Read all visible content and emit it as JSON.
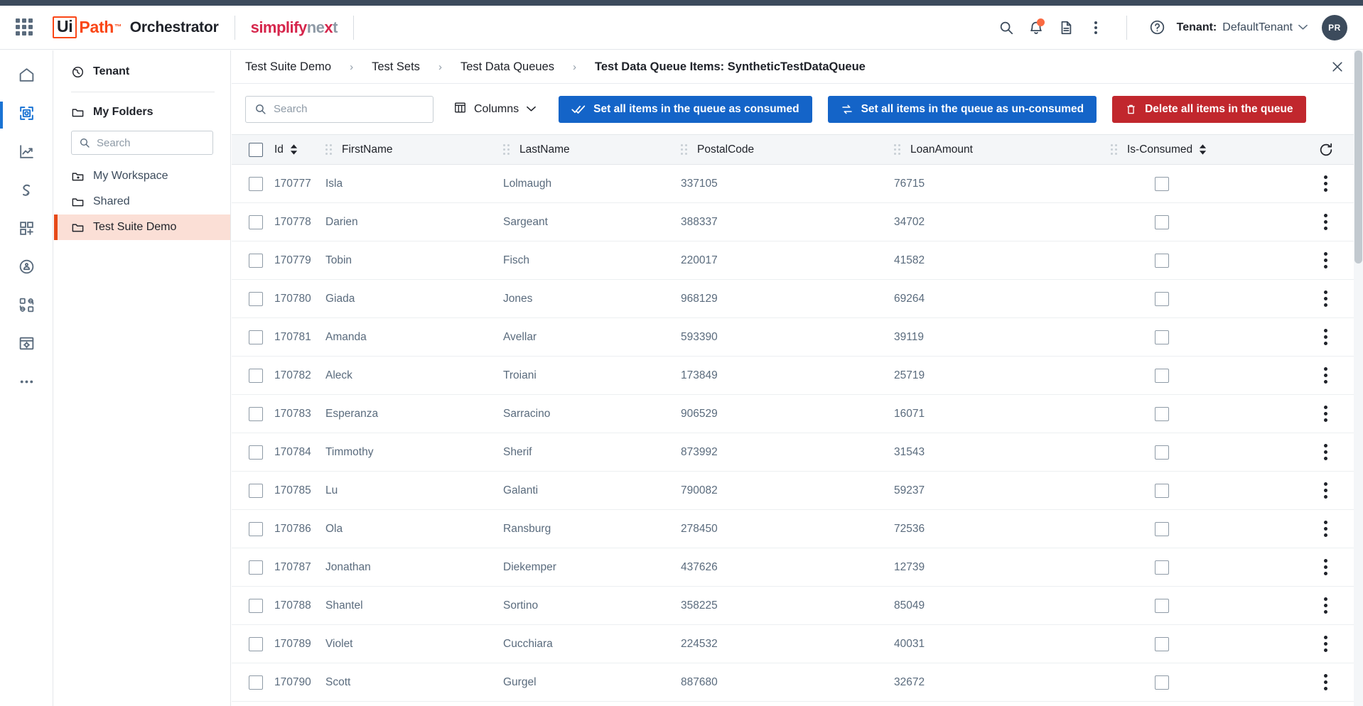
{
  "header": {
    "apps_icon": "waffle-grid-icon",
    "logo": {
      "ui": "Ui",
      "path": "Path",
      "tm": "™"
    },
    "product": "Orchestrator",
    "partner": {
      "part1": "simplify",
      "part2": "ne",
      "part3": "x",
      "part4": "t"
    },
    "icons": [
      "search-icon",
      "notifications-bell-icon",
      "documentation-page-icon",
      "more-vertical-icon",
      "help-circle-icon"
    ],
    "tenant_label": "Tenant:",
    "tenant_value": "DefaultTenant",
    "avatar_initials": "PR",
    "accent_orange": "#fa4616",
    "accent_blue": "#1464c8",
    "accent_red": "#c1272d",
    "strip_color": "#3c4b5c"
  },
  "rail": {
    "items": [
      {
        "name": "home",
        "icon": "home-icon",
        "active": false
      },
      {
        "name": "automations",
        "icon": "automations-icon",
        "active": true
      },
      {
        "name": "monitoring",
        "icon": "monitoring-chart-icon",
        "active": false
      },
      {
        "name": "queues",
        "icon": "queues-icon",
        "active": false
      },
      {
        "name": "apps",
        "icon": "apps-add-icon",
        "active": false
      },
      {
        "name": "robots",
        "icon": "robot-icon",
        "active": false
      },
      {
        "name": "integrations",
        "icon": "integrations-icon",
        "active": false
      },
      {
        "name": "storage",
        "icon": "storage-bucket-icon",
        "active": false
      },
      {
        "name": "more",
        "icon": "more-horizontal-icon",
        "active": false
      }
    ]
  },
  "folders": {
    "tenant_row": "Tenant",
    "my_folders": "My Folders",
    "search_placeholder": "Search",
    "items": [
      {
        "label": "My Workspace",
        "icon": "folder-star-icon",
        "selected": false
      },
      {
        "label": "Shared",
        "icon": "folder-icon",
        "selected": false
      },
      {
        "label": "Test Suite Demo",
        "icon": "folder-icon",
        "selected": true
      }
    ]
  },
  "breadcrumb": {
    "items": [
      "Test Suite Demo",
      "Test Sets",
      "Test Data Queues",
      "Test Data Queue Items: SyntheticTestDataQueue"
    ],
    "separator": "›",
    "close_icon": "close-icon"
  },
  "toolbar": {
    "search_placeholder": "Search",
    "columns_label": "Columns",
    "columns_icon": "columns-table-icon",
    "chevron_icon": "chevron-down-icon",
    "set_consumed_label": "Set all items in the queue as consumed",
    "set_consumed_icon": "double-check-icon",
    "set_unconsumed_label": "Set all items in the queue as un-consumed",
    "set_unconsumed_icon": "swap-arrows-icon",
    "delete_all_label": "Delete all items in the queue",
    "delete_all_icon": "trash-icon"
  },
  "table": {
    "select_all_name": "select-all-checkbox",
    "refresh_icon": "refresh-icon",
    "columns": [
      {
        "key": "id",
        "label": "Id",
        "sortable": true
      },
      {
        "key": "first",
        "label": "FirstName",
        "sortable": false
      },
      {
        "key": "last",
        "label": "LastName",
        "sortable": false
      },
      {
        "key": "postal",
        "label": "PostalCode",
        "sortable": false
      },
      {
        "key": "loan",
        "label": "LoanAmount",
        "sortable": false
      },
      {
        "key": "consumed",
        "label": "Is-Consumed",
        "sortable": true
      }
    ],
    "rows": [
      {
        "id": "170777",
        "first": "Isla",
        "last": "Lolmaugh",
        "postal": "337105",
        "loan": "76715",
        "consumed": false
      },
      {
        "id": "170778",
        "first": "Darien",
        "last": "Sargeant",
        "postal": "388337",
        "loan": "34702",
        "consumed": false
      },
      {
        "id": "170779",
        "first": "Tobin",
        "last": "Fisch",
        "postal": "220017",
        "loan": "41582",
        "consumed": false
      },
      {
        "id": "170780",
        "first": "Giada",
        "last": "Jones",
        "postal": "968129",
        "loan": "69264",
        "consumed": false
      },
      {
        "id": "170781",
        "first": "Amanda",
        "last": "Avellar",
        "postal": "593390",
        "loan": "39119",
        "consumed": false
      },
      {
        "id": "170782",
        "first": "Aleck",
        "last": "Troiani",
        "postal": "173849",
        "loan": "25719",
        "consumed": false
      },
      {
        "id": "170783",
        "first": "Esperanza",
        "last": "Sarracino",
        "postal": "906529",
        "loan": "16071",
        "consumed": false
      },
      {
        "id": "170784",
        "first": "Timmothy",
        "last": "Sherif",
        "postal": "873992",
        "loan": "31543",
        "consumed": false
      },
      {
        "id": "170785",
        "first": "Lu",
        "last": "Galanti",
        "postal": "790082",
        "loan": "59237",
        "consumed": false
      },
      {
        "id": "170786",
        "first": "Ola",
        "last": "Ransburg",
        "postal": "278450",
        "loan": "72536",
        "consumed": false
      },
      {
        "id": "170787",
        "first": "Jonathan",
        "last": "Diekemper",
        "postal": "437626",
        "loan": "12739",
        "consumed": false
      },
      {
        "id": "170788",
        "first": "Shantel",
        "last": "Sortino",
        "postal": "358225",
        "loan": "85049",
        "consumed": false
      },
      {
        "id": "170789",
        "first": "Violet",
        "last": "Cucchiara",
        "postal": "224532",
        "loan": "40031",
        "consumed": false
      },
      {
        "id": "170790",
        "first": "Scott",
        "last": "Gurgel",
        "postal": "887680",
        "loan": "32672",
        "consumed": false
      }
    ]
  }
}
